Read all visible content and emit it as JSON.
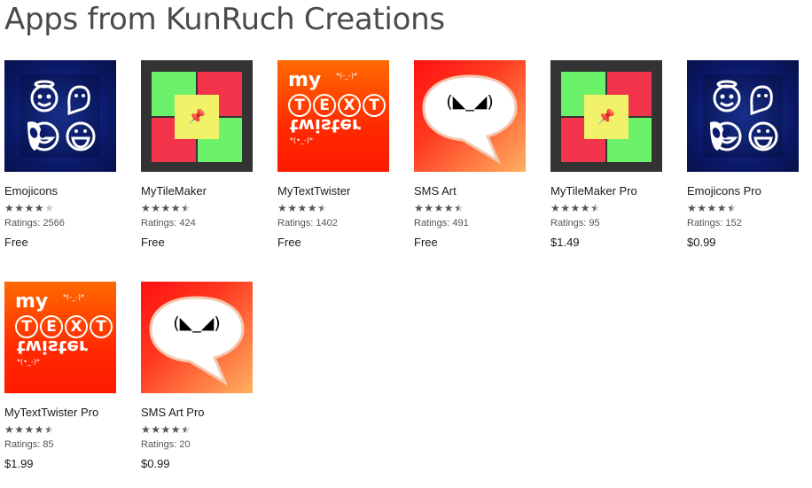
{
  "page": {
    "title": "Apps from KunRuch Creations"
  },
  "apps": [
    {
      "name": "Emojicons",
      "rating": 4,
      "ratings_label": "Ratings: 2566",
      "price": "Free",
      "thumb": "emojicons"
    },
    {
      "name": "MyTileMaker",
      "rating": 4.5,
      "ratings_label": "Ratings: 424",
      "price": "Free",
      "thumb": "tilemaker"
    },
    {
      "name": "MyTextTwister",
      "rating": 4.5,
      "ratings_label": "Ratings: 1402",
      "price": "Free",
      "thumb": "texttwister"
    },
    {
      "name": "SMS Art",
      "rating": 4.5,
      "ratings_label": "Ratings: 491",
      "price": "Free",
      "thumb": "smsart"
    },
    {
      "name": "MyTileMaker Pro",
      "rating": 4.5,
      "ratings_label": "Ratings: 95",
      "price": "$1.49",
      "thumb": "tilemaker"
    },
    {
      "name": "Emojicons Pro",
      "rating": 4.5,
      "ratings_label": "Ratings: 152",
      "price": "$0.99",
      "thumb": "emojicons"
    },
    {
      "name": "MyTextTwister Pro",
      "rating": 4.5,
      "ratings_label": "Ratings: 85",
      "price": "$1.99",
      "thumb": "texttwister"
    },
    {
      "name": "SMS Art Pro",
      "rating": 4.5,
      "ratings_label": "Ratings: 20",
      "price": "$0.99",
      "thumb": "smsart"
    }
  ],
  "thumb_text": {
    "twister_my": "my",
    "twister_text": "TEXT",
    "twister_word": "twister",
    "twister_face1": "*(-_-)*",
    "twister_face2": "*(•_-)*",
    "sms_face": "(◣_◢)"
  },
  "colors": {
    "tile_green": "#6cf26a",
    "tile_red": "#f2354a",
    "tile_yellow": "#f2f26a",
    "emoji_blue": "#0b1a6b"
  }
}
